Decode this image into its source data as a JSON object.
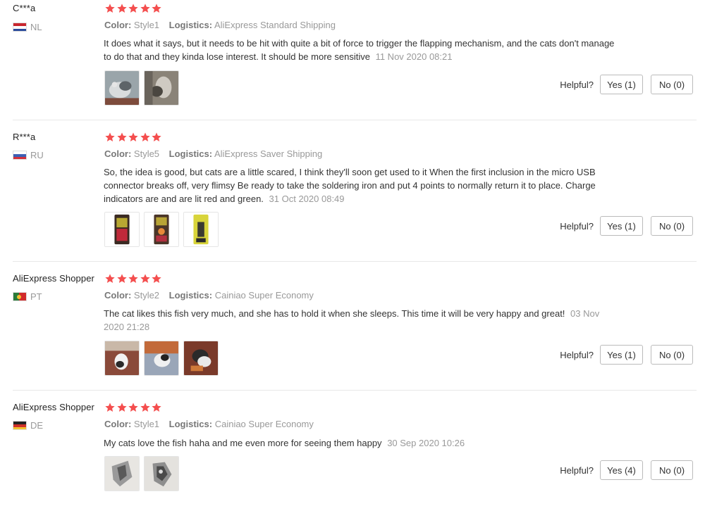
{
  "labels": {
    "color_key": "Color:",
    "logistics_key": "Logistics:",
    "helpful": "Helpful?"
  },
  "reviews": [
    {
      "user": "C***a",
      "country": "NL",
      "rating": 5,
      "color": "Style1",
      "logistics": "AliExpress Standard Shipping",
      "text": "It does what it says, but it needs to be hit with quite a bit of force to trigger the flapping mechanism, and the cats don't manage to do that and they kinda lose interest. It should be more sensitive",
      "date": "11 Nov 2020 08:21",
      "yes_label": "Yes (1)",
      "no_label": "No (0)"
    },
    {
      "user": "R***a",
      "country": "RU",
      "rating": 5,
      "color": "Style5",
      "logistics": "AliExpress Saver Shipping",
      "text": "So, the idea is good, but cats are a little scared, I think they'll soon get used to it When the first inclusion in the micro USB connector breaks off, very flimsy Be ready to take the soldering iron and put 4 points to normally return it to place. Charge indicators are and are lit red and green.",
      "date": "31 Oct 2020 08:49",
      "yes_label": "Yes (1)",
      "no_label": "No (0)"
    },
    {
      "user": "AliExpress Shopper",
      "country": "PT",
      "rating": 5,
      "color": "Style2",
      "logistics": "Cainiao Super Economy",
      "text": "The cat likes this fish very much, and she has to hold it when she sleeps. This time it will be very happy and great!",
      "date": "03 Nov 2020 21:28",
      "yes_label": "Yes (1)",
      "no_label": "No (0)"
    },
    {
      "user": "AliExpress Shopper",
      "country": "DE",
      "rating": 5,
      "color": "Style1",
      "logistics": "Cainiao Super Economy",
      "text": "My cats love the fish haha and me even more for seeing them happy",
      "date": "30 Sep 2020 10:26",
      "yes_label": "Yes (4)",
      "no_label": "No (0)"
    }
  ],
  "colors": {
    "star": "#f44e4e",
    "divider": "#e8e8e8"
  }
}
